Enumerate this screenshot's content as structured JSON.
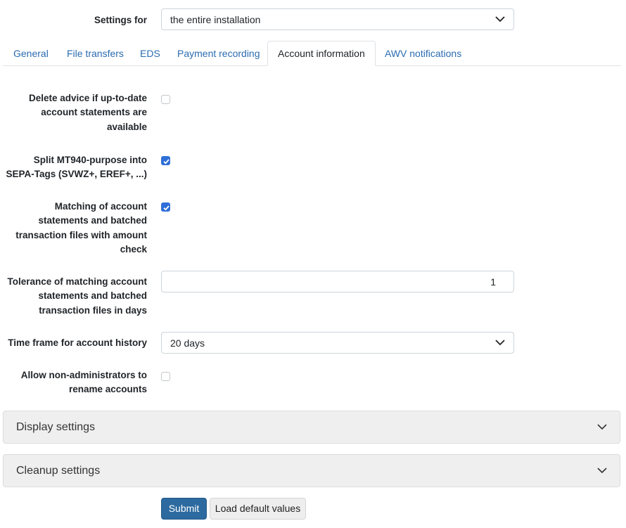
{
  "settings_for": {
    "label": "Settings for",
    "value": "the entire installation"
  },
  "tabs": [
    {
      "label": "General"
    },
    {
      "label": "File transfers"
    },
    {
      "label": "EDS"
    },
    {
      "label": "Payment recording"
    },
    {
      "label": "Account information"
    },
    {
      "label": "AWV notifications"
    }
  ],
  "active_tab": "Account information",
  "fields": {
    "delete_advice": {
      "label": "Delete advice if up-to-date account statements are available",
      "checked": false
    },
    "split_mt940": {
      "label": "Split MT940-purpose into SEPA-Tags (SVWZ+, EREF+, ...)",
      "checked": true
    },
    "matching": {
      "label": "Matching of account statements and batched transaction files with amount check",
      "checked": true
    },
    "tolerance": {
      "label": "Tolerance of matching account statements and batched transaction files in days",
      "value": "1"
    },
    "time_frame": {
      "label": "Time frame for account history",
      "value": "20 days"
    },
    "allow_rename": {
      "label": "Allow non-administrators to rename accounts",
      "checked": false
    }
  },
  "accordions": [
    {
      "title": "Display settings"
    },
    {
      "title": "Cleanup settings"
    }
  ],
  "buttons": {
    "submit": "Submit",
    "load_defaults": "Load default values"
  },
  "colors": {
    "link": "#2b6cb0",
    "checkbox": "#2f6fd8",
    "primary_button": "#2c6aa0"
  },
  "icons": {
    "select_chevron": "chevron-down-icon",
    "checkbox_check": "check-icon"
  }
}
